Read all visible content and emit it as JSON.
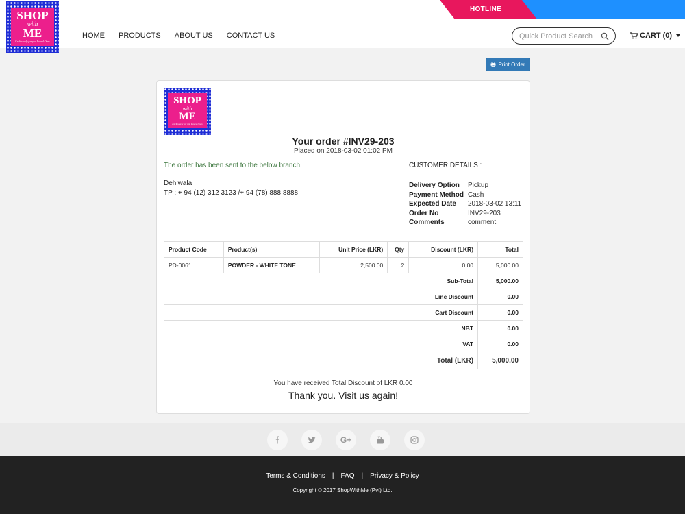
{
  "header": {
    "hotline_label": "HOTLINE",
    "logo": {
      "line1": "SHOP",
      "line2": "with",
      "line3": "ME",
      "tagline": "Exclusively for you Loved Ones"
    },
    "nav": [
      "HOME",
      "PRODUCTS",
      "ABOUT US",
      "CONTACT US"
    ],
    "search": {
      "placeholder": "Quick Product Search",
      "value": ""
    },
    "cart_label": "CART (0)"
  },
  "toolbar": {
    "print_label": "Print Order"
  },
  "order": {
    "title": "Your order #INV29-203",
    "placed": "Placed on 2018-03-02 01:02 PM",
    "branch_message": "The order has been sent to the below branch.",
    "branch_address": [
      "Dehiwala",
      "TP : + 94 (12) 312 3123 /+ 94 (78) 888 8888"
    ],
    "customer_title": "CUSTOMER DETAILS :",
    "details": [
      {
        "label": "Delivery Option",
        "value": "Pickup"
      },
      {
        "label": "Payment Method",
        "value": "Cash"
      },
      {
        "label": "Expected Date",
        "value": "2018-03-02 13:11"
      },
      {
        "label": "Order No",
        "value": "INV29-203"
      },
      {
        "label": "Comments",
        "value": "comment"
      }
    ],
    "table": {
      "headers": [
        "Product Code",
        "Product(s)",
        "Unit Price (LKR)",
        "Qty",
        "Discount (LKR)",
        "Total"
      ],
      "rows": [
        {
          "code": "PD-0061",
          "product": "POWDER - WHITE TONE",
          "unit_price": "2,500.00",
          "qty": "2",
          "discount": "0.00",
          "total": "5,000.00"
        }
      ],
      "summary": [
        {
          "label": "Sub-Total",
          "value": "5,000.00"
        },
        {
          "label": "Line Discount",
          "value": "0.00"
        },
        {
          "label": "Cart Discount",
          "value": "0.00"
        },
        {
          "label": "NBT",
          "value": "0.00"
        },
        {
          "label": "VAT",
          "value": "0.00"
        }
      ],
      "grand_total": {
        "label": "Total (LKR)",
        "value": "5,000.00"
      }
    },
    "discount_message": "You have received Total Discount of LKR 0.00",
    "thanks": "Thank you. Visit us again!"
  },
  "social": {
    "icons": [
      "facebook-icon",
      "twitter-icon",
      "google-plus-icon",
      "youtube-icon",
      "instagram-icon"
    ],
    "google_plus_glyph": "G+"
  },
  "footer": {
    "links": [
      "Terms & Conditions",
      "FAQ",
      "Privacy & Policy"
    ],
    "separator": "|",
    "copyright": "Copyright © 2017 ShopWithMe (Pvt) Ltd."
  },
  "colors": {
    "hotline_pink": "#e8175d",
    "hotline_blue": "#1e90ff",
    "logo_pink": "#ec1f8c",
    "logo_blue": "#1f2ed6",
    "button_blue": "#337ab7",
    "success_green": "#3c763d",
    "footer_dark": "#222222"
  }
}
